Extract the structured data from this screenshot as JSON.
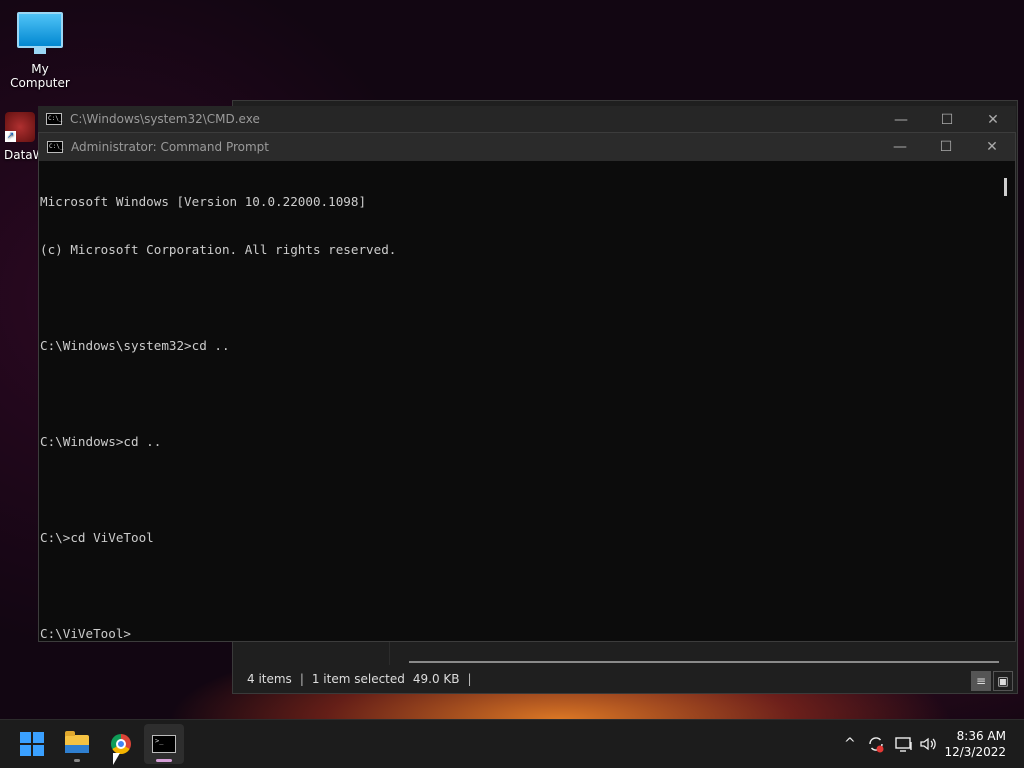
{
  "desktop": {
    "icons": [
      {
        "label": "My Computer"
      },
      {
        "label": "DataW"
      }
    ]
  },
  "explorer": {
    "status": {
      "items": "4 items",
      "selected": "1 item selected",
      "size": "49.0 KB",
      "divider": "|"
    }
  },
  "cmd_back": {
    "title": "C:\\Windows\\system32\\CMD.exe"
  },
  "cmd_front": {
    "title": "Administrator: Command Prompt",
    "lines": [
      "Microsoft Windows [Version 10.0.22000.1098]",
      "(c) Microsoft Corporation. All rights reserved.",
      "",
      "C:\\Windows\\system32>cd ..",
      "",
      "C:\\Windows>cd ..",
      "",
      "C:\\>cd ViVeTool",
      "",
      "C:\\ViVeTool>"
    ]
  },
  "window_controls": {
    "minimize": "—",
    "maximize": "☐",
    "close": "✕"
  },
  "taskbar": {
    "apps": [
      {
        "icon": "windows-start-icon"
      },
      {
        "icon": "file-explorer-icon"
      },
      {
        "icon": "chrome-icon"
      },
      {
        "icon": "command-prompt-icon"
      }
    ],
    "tray": {
      "chevron": "^",
      "volume": "🔊"
    },
    "clock": {
      "time": "8:36 AM",
      "date": "12/3/2022"
    }
  },
  "colors": {
    "console_bg": "#0c0c0c",
    "console_text": "#cccccc",
    "taskbar_bg": "#1c1c1c",
    "start_blue": "#3aa0ff"
  }
}
